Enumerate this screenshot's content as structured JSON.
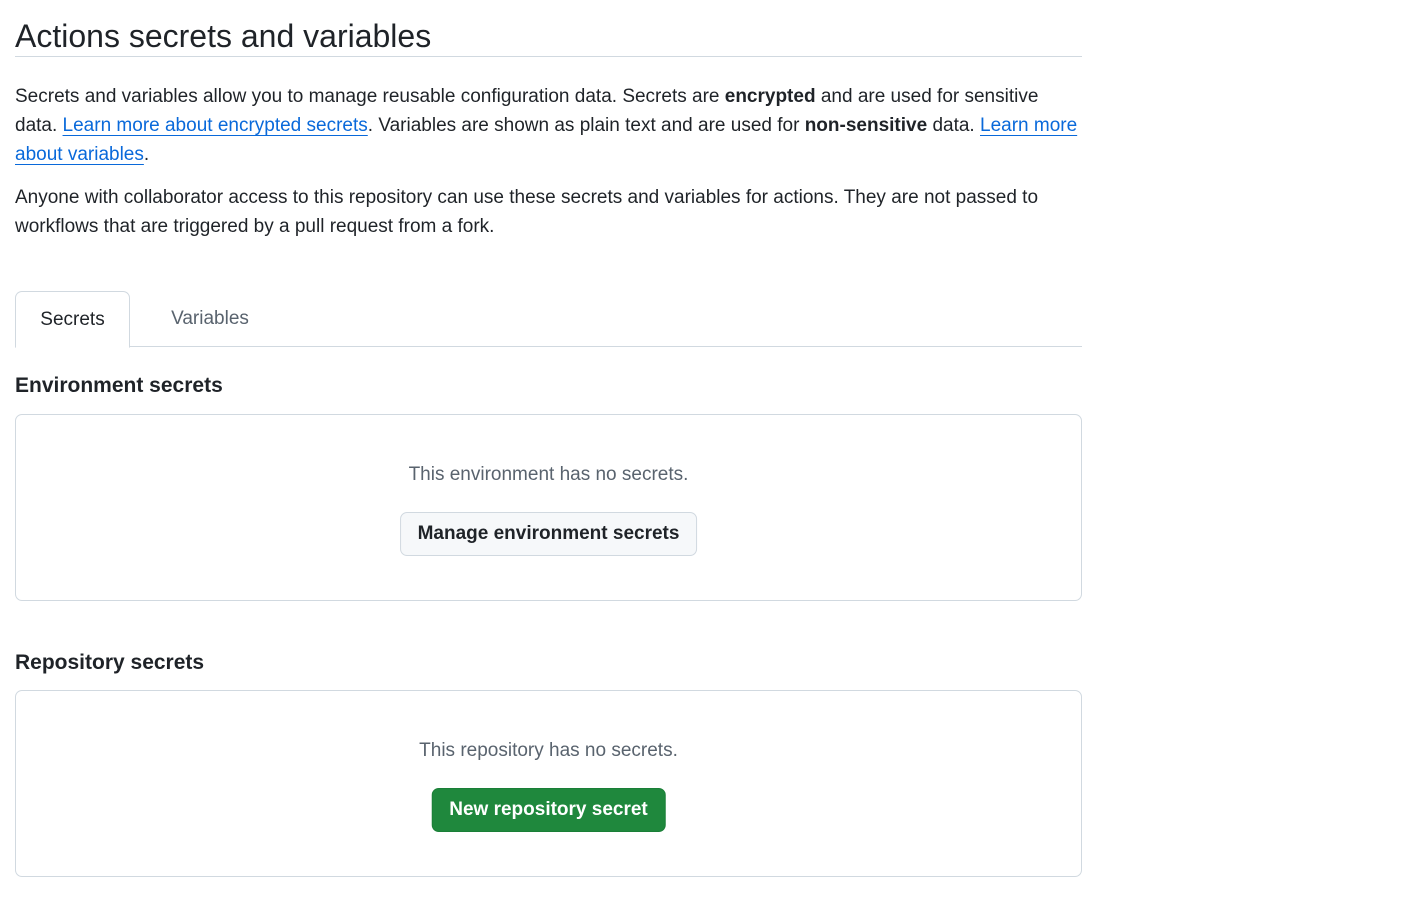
{
  "page": {
    "title": "Actions secrets and variables"
  },
  "intro": {
    "p1_part1": "Secrets and variables allow you to manage reusable configuration data. Secrets are ",
    "p1_bold1": "encrypted",
    "p1_part2": " and are used for sensitive data. ",
    "p1_link1": "Learn more about encrypted secrets",
    "p1_part3": ". Variables are shown as plain text and are used for ",
    "p1_bold2": "non-sensitive",
    "p1_part4": " data. ",
    "p1_link2": "Learn more about variables",
    "p1_part5": ".",
    "p2": "Anyone with collaborator access to this repository can use these secrets and variables for actions. They are not passed to workflows that are triggered by a pull request from a fork."
  },
  "tabs": [
    {
      "label": "Secrets",
      "selected": true
    },
    {
      "label": "Variables",
      "selected": false
    }
  ],
  "environment_secrets": {
    "heading": "Environment secrets",
    "empty_text": "This environment has no secrets.",
    "button_label": "Manage environment secrets"
  },
  "repository_secrets": {
    "heading": "Repository secrets",
    "empty_text": "This repository has no secrets.",
    "button_label": "New repository secret"
  },
  "colors": {
    "link": "#0969da",
    "primary_button": "#1f883d",
    "border": "#d1d9e0",
    "muted_text": "#59636e"
  }
}
